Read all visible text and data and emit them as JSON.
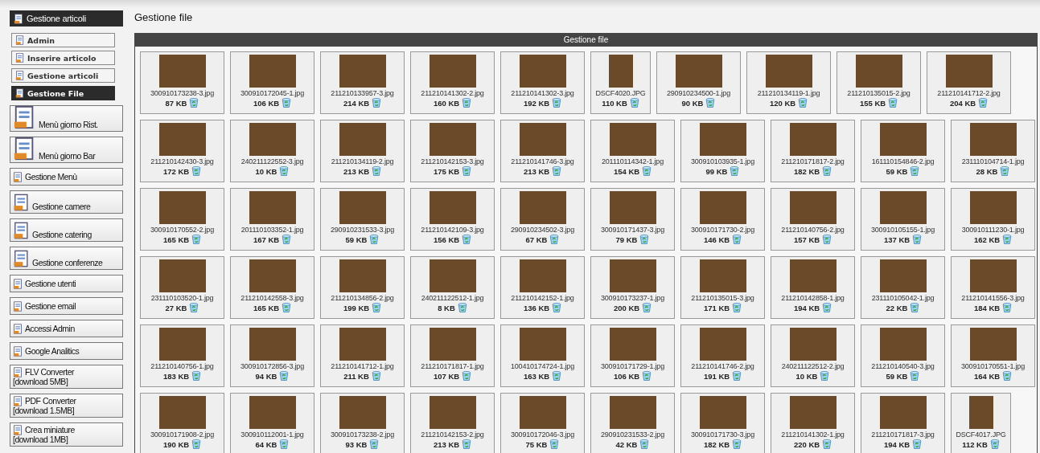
{
  "sidebar": {
    "header": "Gestione articoli",
    "subitems": [
      {
        "label": "Admin",
        "selected": false
      },
      {
        "label": "Inserire articolo",
        "selected": false
      },
      {
        "label": "Gestione articoli",
        "selected": false
      },
      {
        "label": "Gestione File",
        "selected": true
      }
    ],
    "items": [
      {
        "kind": "large",
        "lines": [
          "Menù giorno Rist."
        ]
      },
      {
        "kind": "large",
        "lines": [
          "Menù giorno Bar"
        ]
      },
      {
        "kind": "small",
        "lines": [
          "Gestione Menù"
        ]
      },
      {
        "kind": "medium",
        "lines": [
          "Gestione camere"
        ]
      },
      {
        "kind": "medium",
        "lines": [
          "Gestione catering"
        ]
      },
      {
        "kind": "medium",
        "lines": [
          "Gestione conferenze"
        ]
      },
      {
        "kind": "small",
        "lines": [
          "Gestione utenti"
        ]
      },
      {
        "kind": "small",
        "lines": [
          "Gestione email"
        ]
      },
      {
        "kind": "small",
        "lines": [
          "Accessi Admin"
        ]
      },
      {
        "kind": "small",
        "lines": [
          "Google Analitics"
        ]
      },
      {
        "kind": "small",
        "lines": [
          "FLV Converter",
          "[download 5MB]"
        ]
      },
      {
        "kind": "small",
        "lines": [
          "PDF Converter",
          "[download 1.5MB]"
        ]
      },
      {
        "kind": "small",
        "lines": [
          "Crea miniature",
          "[download 1MB]"
        ]
      }
    ]
  },
  "page_title": "Gestione file",
  "panel": {
    "title": "Gestione file",
    "rows": [
      [
        {
          "name": "300910173238-3.jpg",
          "size": "87 KB",
          "kind": "landscape"
        },
        {
          "name": "300910172045-1.jpg",
          "size": "106 KB",
          "kind": "landscape"
        },
        {
          "name": "211210133957-3.jpg",
          "size": "214 KB",
          "kind": "landscape"
        },
        {
          "name": "211210141302-2.jpg",
          "size": "160 KB",
          "kind": "landscape"
        },
        {
          "name": "211210141302-3.jpg",
          "size": "192 KB",
          "kind": "landscape"
        },
        {
          "name": "DSCF4020.JPG",
          "size": "110 KB",
          "kind": "portrait"
        },
        {
          "name": "290910234500-1.jpg",
          "size": "90 KB",
          "kind": "landscape"
        },
        {
          "name": "211210134119-1.jpg",
          "size": "120 KB",
          "kind": "landscape"
        },
        {
          "name": "211210135015-2.jpg",
          "size": "155 KB",
          "kind": "landscape"
        },
        {
          "name": "211210141712-2.jpg",
          "size": "204 KB",
          "kind": "landscape"
        }
      ],
      [
        {
          "name": "211210142430-3.jpg",
          "size": "172 KB",
          "kind": "landscape"
        },
        {
          "name": "240211122552-3.jpg",
          "size": "10 KB",
          "kind": "landscape"
        },
        {
          "name": "211210134119-2.jpg",
          "size": "213 KB",
          "kind": "landscape"
        },
        {
          "name": "211210142153-3.jpg",
          "size": "175 KB",
          "kind": "landscape"
        },
        {
          "name": "211210141746-3.jpg",
          "size": "213 KB",
          "kind": "landscape"
        },
        {
          "name": "201110114342-1.jpg",
          "size": "154 KB",
          "kind": "landscape"
        },
        {
          "name": "300910103935-1.jpg",
          "size": "99 KB",
          "kind": "landscape"
        },
        {
          "name": "211210171817-2.jpg",
          "size": "182 KB",
          "kind": "landscape"
        },
        {
          "name": "161110154846-2.jpg",
          "size": "59 KB",
          "kind": "landscape"
        },
        {
          "name": "231110104714-1.jpg",
          "size": "28 KB",
          "kind": "landscape"
        }
      ],
      [
        {
          "name": "300910170552-2.jpg",
          "size": "165 KB",
          "kind": "landscape"
        },
        {
          "name": "201110103352-1.jpg",
          "size": "167 KB",
          "kind": "landscape"
        },
        {
          "name": "290910231533-3.jpg",
          "size": "59 KB",
          "kind": "landscape"
        },
        {
          "name": "211210142109-3.jpg",
          "size": "156 KB",
          "kind": "landscape"
        },
        {
          "name": "290910234502-3.jpg",
          "size": "67 KB",
          "kind": "landscape"
        },
        {
          "name": "300910171437-3.jpg",
          "size": "79 KB",
          "kind": "landscape"
        },
        {
          "name": "300910171730-2.jpg",
          "size": "146 KB",
          "kind": "landscape"
        },
        {
          "name": "211210140756-2.jpg",
          "size": "157 KB",
          "kind": "landscape"
        },
        {
          "name": "300910105155-1.jpg",
          "size": "137 KB",
          "kind": "landscape"
        },
        {
          "name": "300910111230-1.jpg",
          "size": "162 KB",
          "kind": "landscape"
        }
      ],
      [
        {
          "name": "231110103520-1.jpg",
          "size": "27 KB",
          "kind": "landscape"
        },
        {
          "name": "211210142558-3.jpg",
          "size": "165 KB",
          "kind": "landscape"
        },
        {
          "name": "211210134856-2.jpg",
          "size": "199 KB",
          "kind": "landscape"
        },
        {
          "name": "240211122512-1.jpg",
          "size": "8 KB",
          "kind": "landscape"
        },
        {
          "name": "211210142152-1.jpg",
          "size": "136 KB",
          "kind": "landscape"
        },
        {
          "name": "300910173237-1.jpg",
          "size": "200 KB",
          "kind": "landscape"
        },
        {
          "name": "211210135015-3.jpg",
          "size": "171 KB",
          "kind": "landscape"
        },
        {
          "name": "211210142858-1.jpg",
          "size": "194 KB",
          "kind": "landscape"
        },
        {
          "name": "231110105042-1.jpg",
          "size": "22 KB",
          "kind": "landscape"
        },
        {
          "name": "211210141556-3.jpg",
          "size": "184 KB",
          "kind": "landscape"
        }
      ],
      [
        {
          "name": "211210140756-1.jpg",
          "size": "183 KB",
          "kind": "landscape"
        },
        {
          "name": "300910172856-3.jpg",
          "size": "94 KB",
          "kind": "landscape"
        },
        {
          "name": "211210141712-1.jpg",
          "size": "211 KB",
          "kind": "landscape"
        },
        {
          "name": "211210171817-1.jpg",
          "size": "107 KB",
          "kind": "landscape"
        },
        {
          "name": "100410174724-1.jpg",
          "size": "163 KB",
          "kind": "landscape"
        },
        {
          "name": "300910171729-1.jpg",
          "size": "106 KB",
          "kind": "landscape"
        },
        {
          "name": "211210141746-2.jpg",
          "size": "191 KB",
          "kind": "landscape"
        },
        {
          "name": "240211122512-2.jpg",
          "size": "10 KB",
          "kind": "landscape"
        },
        {
          "name": "211210140540-3.jpg",
          "size": "59 KB",
          "kind": "landscape"
        },
        {
          "name": "300910170551-1.jpg",
          "size": "164 KB",
          "kind": "landscape"
        }
      ],
      [
        {
          "name": "300910171908-2.jpg",
          "size": "190 KB",
          "kind": "landscape"
        },
        {
          "name": "300910112001-1.jpg",
          "size": "64 KB",
          "kind": "landscape"
        },
        {
          "name": "300910173238-2.jpg",
          "size": "93 KB",
          "kind": "landscape"
        },
        {
          "name": "211210142153-2.jpg",
          "size": "213 KB",
          "kind": "landscape"
        },
        {
          "name": "300910172046-3.jpg",
          "size": "75 KB",
          "kind": "landscape"
        },
        {
          "name": "290910231533-2.jpg",
          "size": "42 KB",
          "kind": "landscape"
        },
        {
          "name": "300910171730-3.jpg",
          "size": "182 KB",
          "kind": "landscape"
        },
        {
          "name": "211210141302-1.jpg",
          "size": "220 KB",
          "kind": "landscape"
        },
        {
          "name": "211210171817-3.jpg",
          "size": "194 KB",
          "kind": "landscape"
        },
        {
          "name": "DSCF4017.JPG",
          "size": "112 KB",
          "kind": "portrait"
        }
      ]
    ]
  }
}
